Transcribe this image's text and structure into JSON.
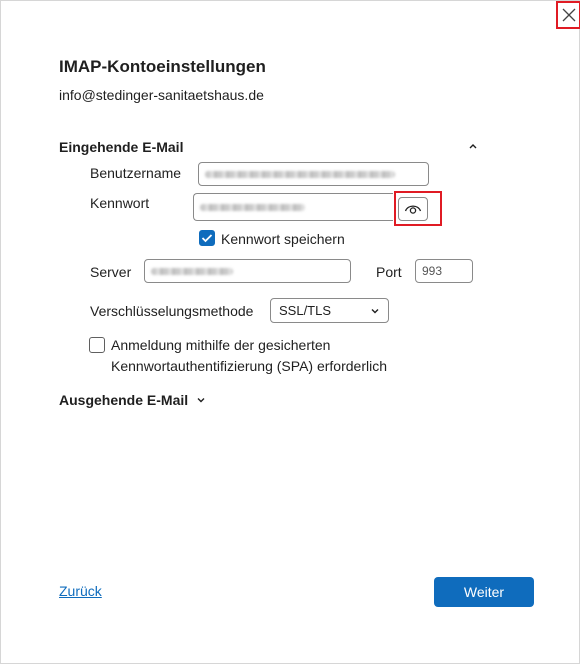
{
  "dialog": {
    "title": "IMAP-Kontoeinstellungen",
    "email": "info@stedinger-sanitaetshaus.de"
  },
  "incoming": {
    "heading": "Eingehende E-Mail",
    "expanded": true,
    "username_label": "Benutzername",
    "password_label": "Kennwort",
    "save_password_label": "Kennwort speichern",
    "save_password_checked": true,
    "server_label": "Server",
    "port_label": "Port",
    "port_value": "993",
    "encryption_label": "Verschlüsselungsmethode",
    "encryption_value": "SSL/TLS",
    "spa_label_line1": "Anmeldung mithilfe der gesicherten",
    "spa_label_line2": "Kennwortauthentifizierung (SPA) erforderlich",
    "spa_checked": false
  },
  "outgoing": {
    "heading": "Ausgehende E-Mail",
    "expanded": false
  },
  "footer": {
    "back_label": "Zurück",
    "next_label": "Weiter"
  },
  "colors": {
    "accent": "#0f6cbd",
    "highlight": "#e01b24"
  },
  "icons": [
    "close-icon",
    "chevron-up-icon",
    "eye-icon",
    "checkmark-icon",
    "chevron-down-icon"
  ]
}
